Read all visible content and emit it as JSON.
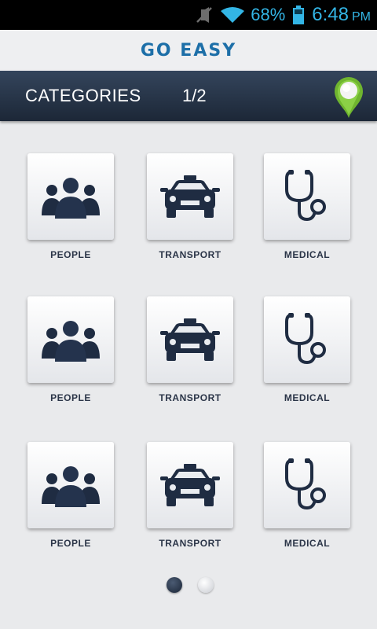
{
  "status_bar": {
    "battery_percent": "68%",
    "time": "6:48",
    "ampm": "PM",
    "icons": [
      "mute-icon",
      "wifi-icon",
      "battery-icon"
    ],
    "color": "#33b5e5"
  },
  "header": {
    "title": "GO EASY"
  },
  "category_bar": {
    "title": "CATEGORIES",
    "page": "1/2",
    "pin_icon": "location-pin-icon"
  },
  "tiles": [
    {
      "label": "PEOPLE",
      "icon": "people-icon"
    },
    {
      "label": "TRANSPORT",
      "icon": "taxi-icon"
    },
    {
      "label": "MEDICAL",
      "icon": "stethoscope-icon"
    },
    {
      "label": "PEOPLE",
      "icon": "people-icon"
    },
    {
      "label": "TRANSPORT",
      "icon": "taxi-icon"
    },
    {
      "label": "MEDICAL",
      "icon": "stethoscope-icon"
    },
    {
      "label": "PEOPLE",
      "icon": "people-icon"
    },
    {
      "label": "TRANSPORT",
      "icon": "taxi-icon"
    },
    {
      "label": "MEDICAL",
      "icon": "stethoscope-icon"
    }
  ],
  "pager": {
    "current_page": 1,
    "total_pages": 2
  },
  "colors": {
    "accent": "#1d6fa8",
    "bar_dark": "#1c2737",
    "icon": "#1f2c42",
    "pin_green": "#7cc23a"
  }
}
